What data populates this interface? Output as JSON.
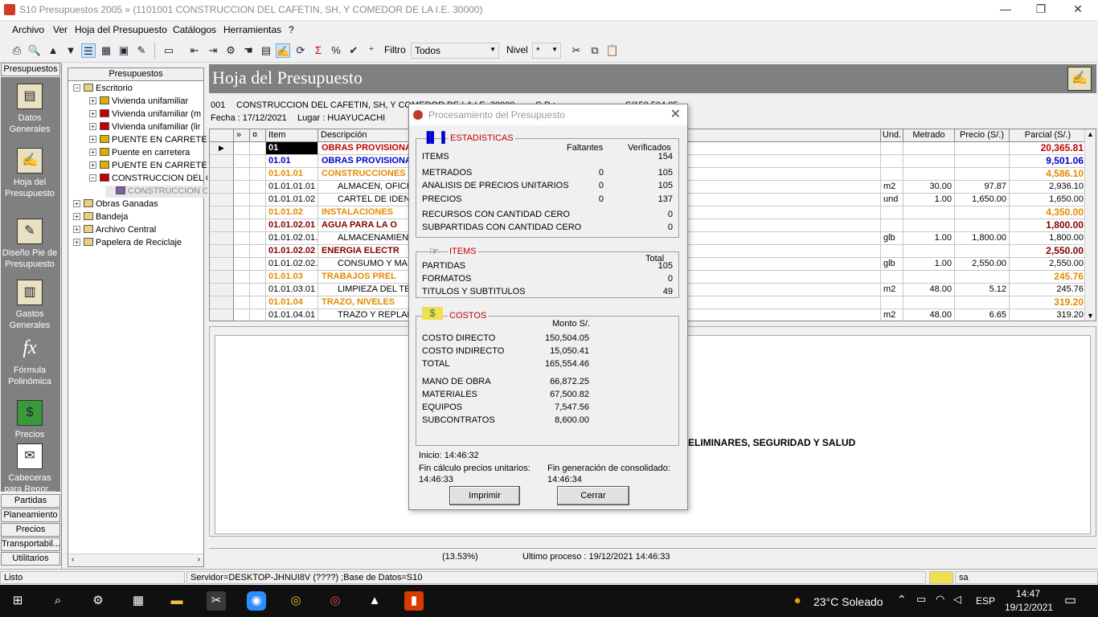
{
  "window": {
    "title": "S10 Presupuestos 2005 » (1101001 CONSTRUCCION DEL CAFETIN, SH, Y COMEDOR DE LA I.E. 30000)",
    "min": "—",
    "max": "❐",
    "close": "✕"
  },
  "menu": [
    "Archivo",
    "Ver",
    "Hoja del Presupuesto",
    "Catálogos",
    "Herramientas",
    "?"
  ],
  "toolbar": {
    "filtro_label": "Filtro",
    "filtro_value": "Todos",
    "nivel_label": "Nivel",
    "nivel_value": "*"
  },
  "left_tabs": {
    "top": "Presupuestos",
    "items": [
      "Datos Generales",
      "Hoja del Presupuesto",
      "Diseño Pie de Presupuesto",
      "Gastos Generales",
      "Fórmula Polinómica",
      "Precios",
      "Cabeceras para Repor..."
    ],
    "bottom": [
      "Partidas Ppta...",
      "Planeamiento",
      "Precios",
      "Transportabil...",
      "Utilitarios"
    ]
  },
  "tree": {
    "header": "Presupuestos",
    "nodes": [
      {
        "label": "Escritorio",
        "lvl": 0,
        "ex": "−"
      },
      {
        "label": "Vivienda unifamiliar",
        "lvl": 1,
        "ex": "+",
        "c": "#d8b000"
      },
      {
        "label": "Vivienda unifamiliar (m",
        "lvl": 1,
        "ex": "+",
        "c": "#c00000"
      },
      {
        "label": "Vivienda unifamiliar (lir",
        "lvl": 1,
        "ex": "+",
        "c": "#c00000"
      },
      {
        "label": "PUENTE EN CARRETER",
        "lvl": 1,
        "ex": "+",
        "c": "#d8b000"
      },
      {
        "label": "Puente en carretera",
        "lvl": 1,
        "ex": "+",
        "c": "#d8b000"
      },
      {
        "label": "PUENTE EN CARRETER",
        "lvl": 1,
        "ex": "+",
        "c": "#d8b000"
      },
      {
        "label": "CONSTRUCCION DEL C",
        "lvl": 1,
        "ex": "−",
        "c": "#c00000"
      },
      {
        "label": "CONSTRUCCION D",
        "lvl": 2,
        "ex": "",
        "c": "#8060a0"
      },
      {
        "label": "Obras Ganadas",
        "lvl": 0,
        "ex": "+"
      },
      {
        "label": "Bandeja",
        "lvl": 0,
        "ex": "+"
      },
      {
        "label": "Archivo Central",
        "lvl": 0,
        "ex": "+"
      },
      {
        "label": "Papelera de Reciclaje",
        "lvl": 0,
        "ex": "+"
      }
    ]
  },
  "main": {
    "title": "Hoja del Presupuesto",
    "code": "001",
    "project": "CONSTRUCCION DEL CAFETIN, SH, Y COMEDOR DE LA I.E. 30000",
    "cd_label": "C.D.:",
    "cd_value": "S/150,504.05",
    "fecha": "Fecha : 17/12/2021",
    "lugar": "Lugar : HUAYUCACHI"
  },
  "grid": {
    "headers": [
      "»",
      "¤",
      "Item",
      "Descripción",
      "Und.",
      "Metrado",
      "Precio (S/.)",
      "Parcial (S/.)"
    ],
    "rows": [
      {
        "item": "01",
        "desc": "OBRAS PROVISIONALES",
        "und": "",
        "met": "",
        "pre": "",
        "par": "20,365.81",
        "cls": "red b",
        "sel": true
      },
      {
        "item": "01.01",
        "desc": "OBRAS PROVISIONALES",
        "und": "",
        "met": "",
        "pre": "",
        "par": "9,501.06",
        "cls": "blue b"
      },
      {
        "item": "01.01.01",
        "desc": "CONSTRUCCIONES",
        "und": "",
        "met": "",
        "pre": "",
        "par": "4,586.10",
        "cls": "orange b"
      },
      {
        "item": "01.01.01.01",
        "desc": "ALMACEN, OFICINA",
        "und": "m2",
        "met": "30.00",
        "pre": "97.87",
        "par": "2,936.10",
        "cls": ""
      },
      {
        "item": "01.01.01.02",
        "desc": "CARTEL DE IDENT",
        "und": "und",
        "met": "1.00",
        "pre": "1,650.00",
        "par": "1,650.00",
        "cls": ""
      },
      {
        "item": "01.01.02",
        "desc": "INSTALACIONES",
        "und": "",
        "met": "",
        "pre": "",
        "par": "4,350.00",
        "cls": "orange b"
      },
      {
        "item": "01.01.02.01",
        "desc": "AGUA PARA LA O",
        "und": "",
        "met": "",
        "pre": "",
        "par": "1,800.00",
        "cls": "maroon b"
      },
      {
        "item": "01.01.02.01.",
        "desc": "ALMACENAMIEN",
        "und": "glb",
        "met": "1.00",
        "pre": "1,800.00",
        "par": "1,800.00",
        "cls": ""
      },
      {
        "item": "01.01.02.02",
        "desc": "ENERGIA ELECTR",
        "und": "",
        "met": "",
        "pre": "",
        "par": "2,550.00",
        "cls": "maroon b"
      },
      {
        "item": "01.01.02.02.",
        "desc": "CONSUMO Y MA",
        "und": "glb",
        "met": "1.00",
        "pre": "2,550.00",
        "par": "2,550.00",
        "cls": ""
      },
      {
        "item": "01.01.03",
        "desc": "TRABAJOS PREL",
        "und": "",
        "met": "",
        "pre": "",
        "par": "245.76",
        "cls": "orange b"
      },
      {
        "item": "01.01.03.01",
        "desc": "LIMPIEZA DEL TER",
        "und": "m2",
        "met": "48.00",
        "pre": "5.12",
        "par": "245.76",
        "cls": ""
      },
      {
        "item": "01.01.04",
        "desc": "TRAZO, NIVELES",
        "und": "",
        "met": "",
        "pre": "",
        "par": "319.20",
        "cls": "orange b"
      },
      {
        "item": "01.01.04.01",
        "desc": "TRAZO Y REPLAN",
        "und": "m2",
        "met": "48.00",
        "pre": "6.65",
        "par": "319.20",
        "cls": ""
      }
    ]
  },
  "lower_text": "ELIMINARES, SEGURIDAD Y SALUD",
  "status2": {
    "pct": "(13.53%)",
    "last": "Ultimo proceso : 19/12/2021 14:46:33"
  },
  "statusbar": {
    "left": "Listo",
    "server": "Servidor=DESKTOP-JHNUI8V (????) ;Base de Datos=S10",
    "user": "sa"
  },
  "dialog": {
    "title": "Procesamiento del Presupuesto",
    "close": "✕",
    "est": {
      "label": "ESTADISTICAS",
      "h_falt": "Faltantes",
      "h_ver": "Verificados",
      "rows": [
        {
          "l": "ITEMS",
          "f": "",
          "v": "154"
        },
        {
          "l": "METRADOS",
          "f": "0",
          "v": "105"
        },
        {
          "l": "ANALISIS DE PRECIOS UNITARIOS",
          "f": "0",
          "v": "105"
        },
        {
          "l": "PRECIOS",
          "f": "0",
          "v": "137"
        },
        {
          "l": "RECURSOS CON CANTIDAD CERO",
          "f": "",
          "v": "0"
        },
        {
          "l": "SUBPARTIDAS CON CANTIDAD CERO",
          "f": "",
          "v": "0"
        }
      ]
    },
    "items": {
      "label": "ITEMS",
      "h_total": "Total",
      "rows": [
        {
          "l": "PARTIDAS",
          "v": "105"
        },
        {
          "l": "FORMATOS",
          "v": "0"
        },
        {
          "l": "TITULOS Y SUBTITULOS",
          "v": "49"
        }
      ]
    },
    "costos": {
      "label": "COSTOS",
      "h_monto": "Monto S/.",
      "rows": [
        {
          "l": "COSTO DIRECTO",
          "v": "150,504.05"
        },
        {
          "l": "COSTO INDIRECTO",
          "v": "15,050.41"
        },
        {
          "l": "TOTAL",
          "v": "165,554.46"
        },
        {
          "l": "MANO DE OBRA",
          "v": "66,872.25"
        },
        {
          "l": "MATERIALES",
          "v": "67,500.82"
        },
        {
          "l": "EQUIPOS",
          "v": "7,547.56"
        },
        {
          "l": "SUBCONTRATOS",
          "v": "8,600.00"
        }
      ]
    },
    "inicio": "Inicio: 14:46:32",
    "fin_calc": "Fin cálculo precios unitarios:",
    "fin_calc_t": "14:46:33",
    "fin_gen": "Fin generación de consolidado:",
    "fin_gen_t": "14:46:34",
    "btn_print": "Imprimir",
    "btn_close": "Cerrar"
  },
  "taskbar": {
    "weather": "23°C  Soleado",
    "lang": "ESP",
    "time": "14:47",
    "date": "19/12/2021"
  }
}
